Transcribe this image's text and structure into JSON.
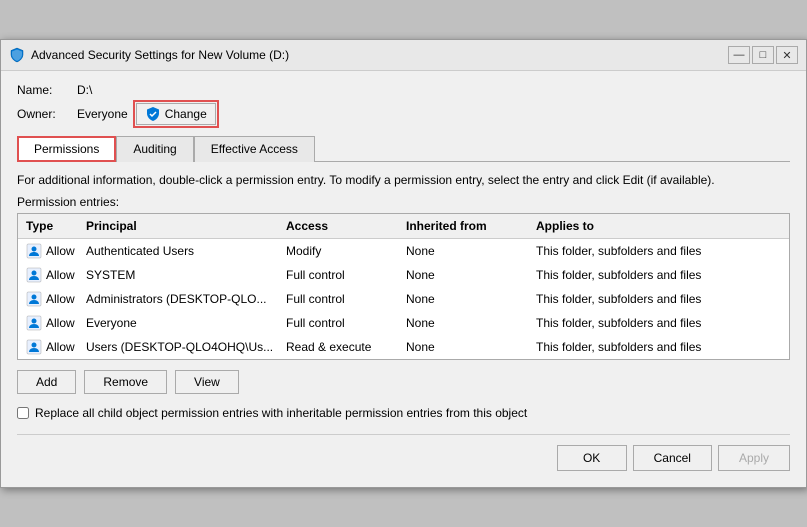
{
  "window": {
    "title": "Advanced Security Settings for New Volume (D:)",
    "icon": "shield"
  },
  "titleControls": {
    "minimize": "—",
    "maximize": "□",
    "close": "✕"
  },
  "fields": {
    "name_label": "Name:",
    "name_value": "D:\\",
    "owner_label": "Owner:",
    "owner_value": "Everyone",
    "change_btn": "Change"
  },
  "tabs": [
    {
      "id": "permissions",
      "label": "Permissions",
      "active": true
    },
    {
      "id": "auditing",
      "label": "Auditing",
      "active": false
    },
    {
      "id": "effective-access",
      "label": "Effective Access",
      "active": false
    }
  ],
  "infoText": "For additional information, double-click a permission entry. To modify a permission entry, select the entry and click Edit (if available).",
  "sectionLabel": "Permission entries:",
  "tableHeaders": [
    "Type",
    "Principal",
    "Access",
    "Inherited from",
    "Applies to"
  ],
  "permissionRows": [
    {
      "type": "Allow",
      "principal": "Authenticated Users",
      "access": "Modify",
      "inherited_from": "None",
      "applies_to": "This folder, subfolders and files"
    },
    {
      "type": "Allow",
      "principal": "SYSTEM",
      "access": "Full control",
      "inherited_from": "None",
      "applies_to": "This folder, subfolders and files"
    },
    {
      "type": "Allow",
      "principal": "Administrators (DESKTOP-QLO...",
      "access": "Full control",
      "inherited_from": "None",
      "applies_to": "This folder, subfolders and files"
    },
    {
      "type": "Allow",
      "principal": "Everyone",
      "access": "Full control",
      "inherited_from": "None",
      "applies_to": "This folder, subfolders and files"
    },
    {
      "type": "Allow",
      "principal": "Users (DESKTOP-QLO4OHQ\\Us...",
      "access": "Read & execute",
      "inherited_from": "None",
      "applies_to": "This folder, subfolders and files"
    }
  ],
  "actionButtons": {
    "add": "Add",
    "remove": "Remove",
    "view": "View"
  },
  "checkboxLabel": "Replace all child object permission entries with inheritable permission entries from this object",
  "footerButtons": {
    "ok": "OK",
    "cancel": "Cancel",
    "apply": "Apply"
  }
}
